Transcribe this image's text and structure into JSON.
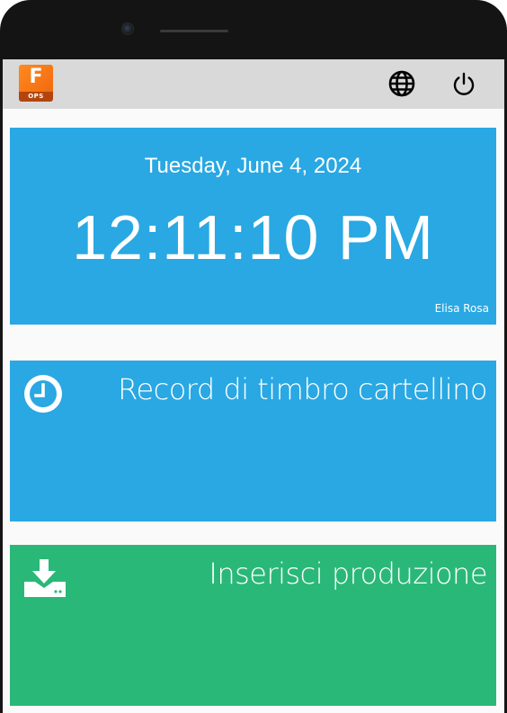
{
  "device": {
    "camera_icon": "front-camera",
    "speaker_icon": "earpiece-speaker"
  },
  "appbar": {
    "logo": {
      "letter": "F",
      "caption": "OPS",
      "colors": {
        "top": "#f26a0f",
        "bottom": "#b3450c"
      }
    },
    "actions": [
      {
        "icon": "globe-icon"
      },
      {
        "icon": "power-icon"
      }
    ]
  },
  "clock": {
    "date": "Tuesday, June 4, 2024",
    "time": "12:11:10 PM",
    "user": "Elisa Rosa"
  },
  "tiles": [
    {
      "title": "Record di timbro cartellino",
      "icon": "clock-icon",
      "color": "#29a8e3"
    },
    {
      "title": "Inserisci produzione",
      "icon": "download-tray-icon",
      "color": "#2ab878"
    }
  ],
  "colors": {
    "appbar": "#d9d9d9",
    "accent_blue": "#29a8e3",
    "accent_green": "#2ab878",
    "background": "#fafafa"
  }
}
